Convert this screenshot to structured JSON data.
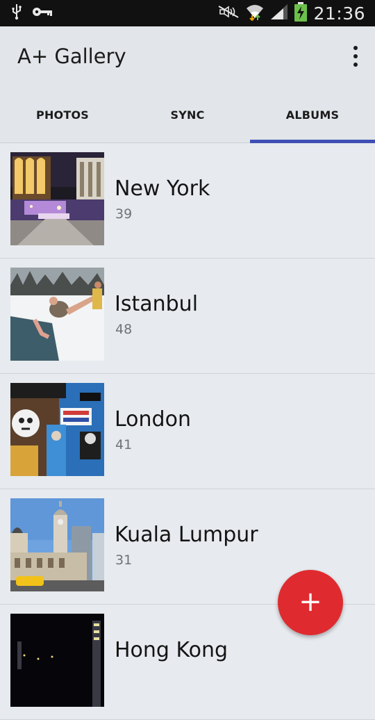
{
  "status_bar": {
    "time": "21:36",
    "icons": [
      "usb-icon",
      "key-icon",
      "mute-icon",
      "wifi-icon",
      "signal-icon",
      "battery-charging-icon"
    ]
  },
  "app_bar": {
    "title": "A+ Gallery",
    "overflow_icon": "more-vert-icon"
  },
  "tabs": [
    {
      "label": "PHOTOS",
      "active": false
    },
    {
      "label": "SYNC",
      "active": false
    },
    {
      "label": "ALBUMS",
      "active": true
    }
  ],
  "albums": [
    {
      "name": "New York",
      "count": "39"
    },
    {
      "name": "Istanbul",
      "count": "48"
    },
    {
      "name": "London",
      "count": "41"
    },
    {
      "name": "Kuala Lumpur",
      "count": "31"
    },
    {
      "name": "Hong Kong",
      "count": ""
    }
  ],
  "fab": {
    "label": "+",
    "icon": "add-icon",
    "color": "#df2b2f"
  },
  "colors": {
    "accent": "#3f4fb5",
    "background": "#e7eaee",
    "status_bar": "#111111"
  }
}
